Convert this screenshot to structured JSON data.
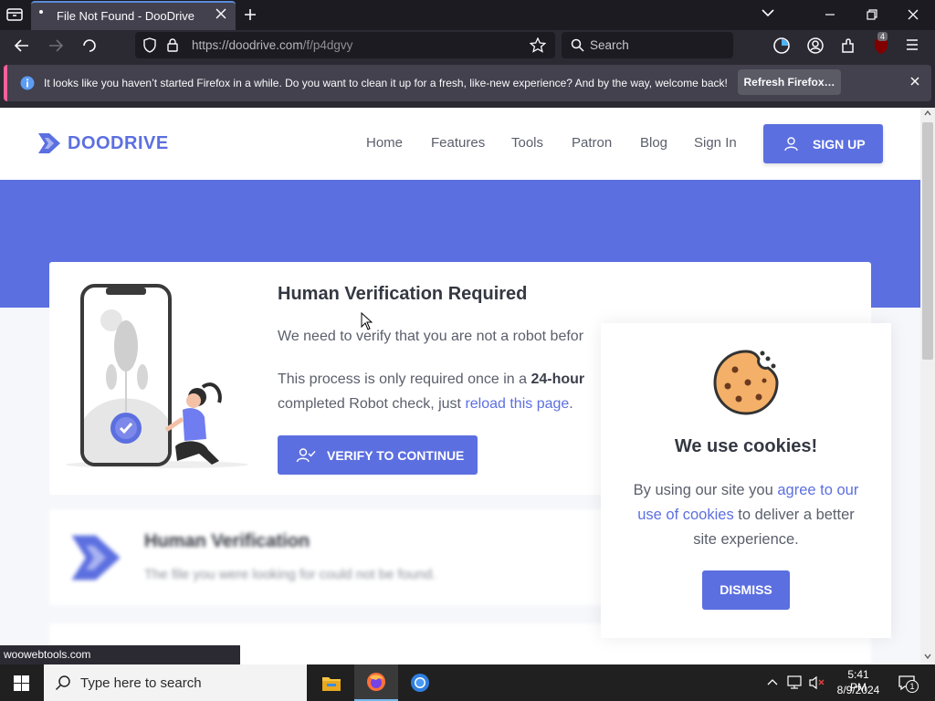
{
  "browser": {
    "tab_title": "File Not Found - DooDrive",
    "url_domain": "https://doodrive.com",
    "url_path": "/f/p4dgvy",
    "search_placeholder": "Search",
    "extension_badge": "4",
    "notification_text": "It looks like you haven’t started Firefox in a while. Do you want to clean it up for a fresh, like-new experience? And by the way, welcome back!",
    "notification_button": "Refresh Firefox…",
    "status_url": "woowebtools.com"
  },
  "site": {
    "logo_text": "DOODRIVE",
    "nav": [
      "Home",
      "Features",
      "Tools",
      "Patron",
      "Blog",
      "Sign In"
    ],
    "signup_label": "SIGN UP",
    "accent_color": "#5c6fe0"
  },
  "verification": {
    "title": "Human Verification Required",
    "line1": "We need to verify that you are not a robot befor",
    "line2_prefix": "This process is only required once in a ",
    "line2_bold": "24-hour",
    "line3_prefix": "completed Robot check, just ",
    "line3_link": "reload this page",
    "line3_suffix": ".",
    "button_label": "VERIFY TO CONTINUE"
  },
  "blurred_card": {
    "title": "Human Verification",
    "text": "The file you were looking for could not be found."
  },
  "cookies": {
    "title": "We use cookies!",
    "text_prefix": "By using our site you ",
    "text_link": "agree to our use of cookies",
    "text_suffix": " to deliver a better site experience.",
    "dismiss_label": "DISMISS"
  },
  "taskbar": {
    "search_placeholder": "Type here to search",
    "time": "5:41 PM",
    "date": "8/9/2024",
    "notification_count": "1"
  }
}
